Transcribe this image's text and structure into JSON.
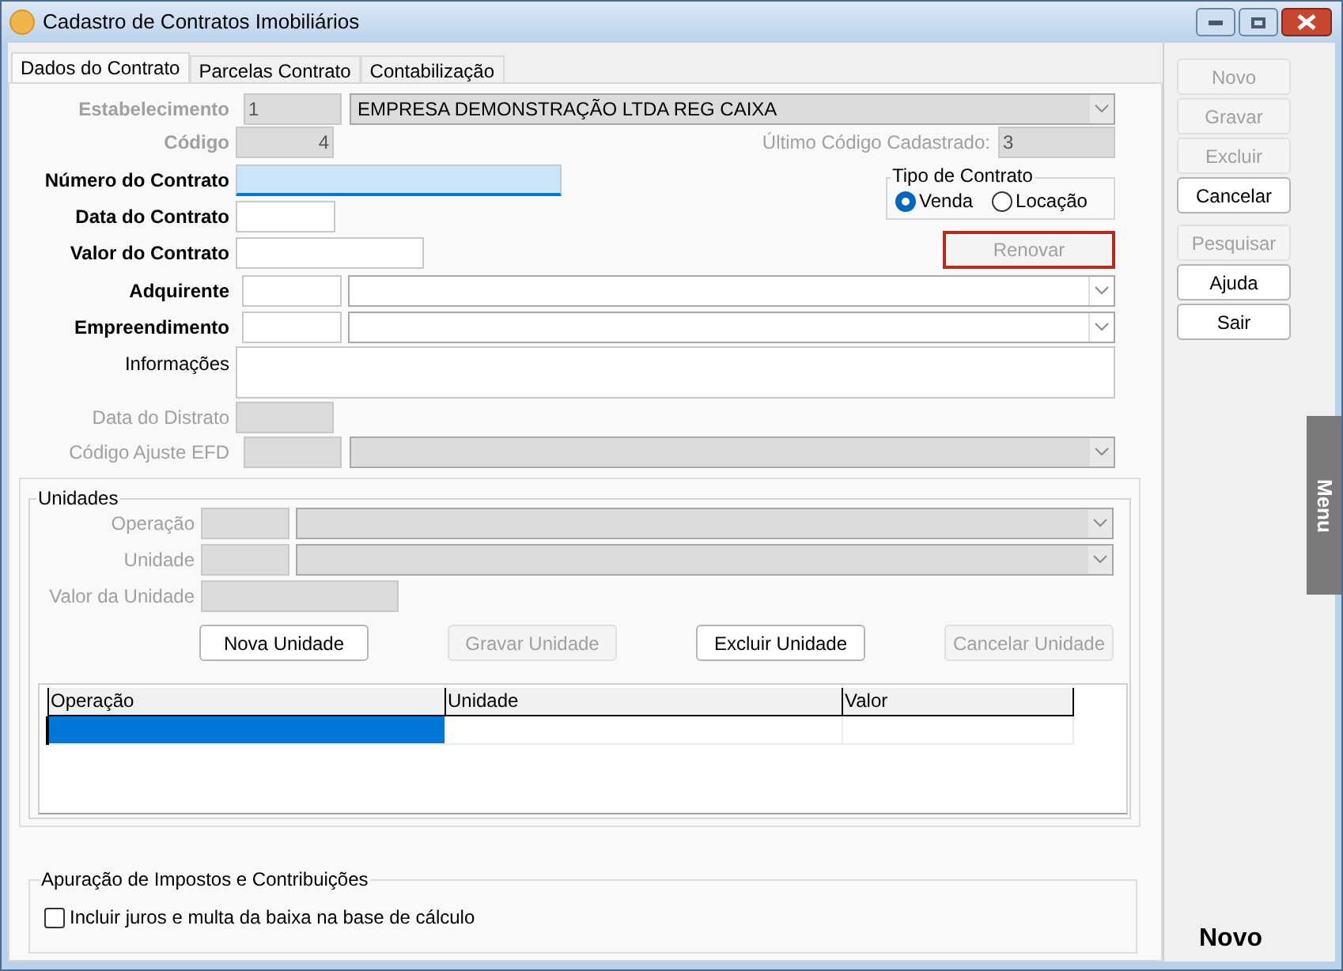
{
  "window": {
    "title": "Cadastro de Contratos Imobiliários"
  },
  "tabs": [
    {
      "label": "Dados do Contrato",
      "selected": true
    },
    {
      "label": "Parcelas Contrato",
      "selected": false
    },
    {
      "label": "Contabilização",
      "selected": false
    }
  ],
  "fields": {
    "establishment": {
      "label": "Estabelecimento",
      "code": "1",
      "value": "EMPRESA DEMONSTRAÇÃO LTDA REG CAIXA",
      "required": true,
      "disabled": true
    },
    "code": {
      "label": "Código",
      "value": "4",
      "required": true,
      "disabled": true
    },
    "last_code": {
      "label": "Último Código Cadastrado:",
      "value": "3",
      "disabled": true
    },
    "number": {
      "label": "Número do Contrato",
      "required": true,
      "disabled": false,
      "focused": true
    },
    "date": {
      "label": "Data do Contrato",
      "required": true,
      "disabled": false
    },
    "value": {
      "label": "Valor do Contrato",
      "required": true,
      "disabled": false
    },
    "acquirer": {
      "label": "Adquirente",
      "required": true,
      "disabled": false
    },
    "development": {
      "label": "Empreendimento",
      "required": true,
      "disabled": false
    },
    "info": {
      "label": "Informações",
      "required": false,
      "disabled": false
    },
    "termination_date": {
      "label": "Data do Distrato",
      "required": false,
      "disabled": true
    },
    "efd_code": {
      "label": "Código Ajuste EFD",
      "required": false,
      "disabled": true
    }
  },
  "contract_type": {
    "label": "Tipo de Contrato",
    "options": [
      {
        "label": "Venda",
        "selected": true
      },
      {
        "label": "Locação",
        "selected": false
      }
    ]
  },
  "renew_button": {
    "label": "Renovar",
    "disabled": true,
    "highlighted": true
  },
  "units": {
    "title": "Unidades",
    "fields": [
      {
        "label": "Operação",
        "kind": "combo",
        "disabled": true
      },
      {
        "label": "Unidade",
        "kind": "combo",
        "disabled": true
      },
      {
        "label": "Valor da Unidade",
        "kind": "text",
        "disabled": true
      }
    ],
    "buttons": [
      {
        "label": "Nova Unidade",
        "disabled": false
      },
      {
        "label": "Gravar Unidade",
        "disabled": true
      },
      {
        "label": "Excluir Unidade",
        "disabled": false
      },
      {
        "label": "Cancelar Unidade",
        "disabled": true
      }
    ],
    "grid": {
      "columns": [
        "Operação",
        "Unidade",
        "Valor"
      ],
      "rows": [
        {
          "selected": true
        }
      ]
    }
  },
  "taxes": {
    "title": "Apuração de Impostos e Contribuições",
    "checkbox": {
      "label": "Incluir juros e multa da baixa na base de cálculo",
      "checked": false
    }
  },
  "side_button_groups": [
    [
      {
        "label": "Novo",
        "disabled": true
      },
      {
        "label": "Gravar",
        "disabled": true
      },
      {
        "label": "Excluir",
        "disabled": true
      },
      {
        "label": "Cancelar",
        "disabled": false
      }
    ],
    [
      {
        "label": "Pesquisar",
        "disabled": true
      },
      {
        "label": "Ajuda",
        "disabled": false
      },
      {
        "label": "Sair",
        "disabled": false
      }
    ]
  ],
  "menu_tab": {
    "label": "Menu"
  },
  "mode": "Novo"
}
